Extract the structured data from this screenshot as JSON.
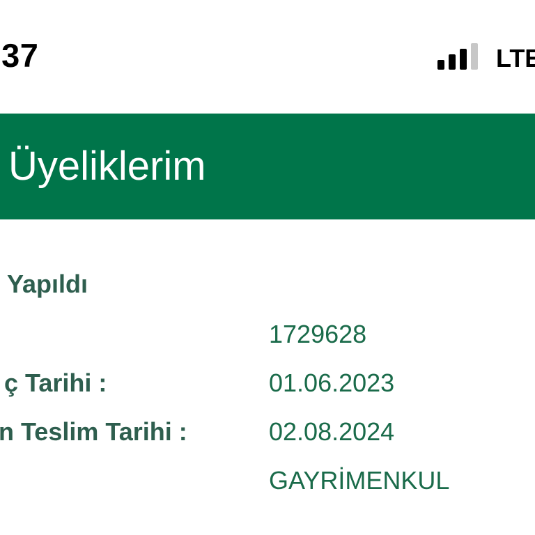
{
  "status_bar": {
    "time": ":37",
    "network": "LTE",
    "signal_bars_active": 3,
    "signal_bars_total": 4
  },
  "header": {
    "title": "Üyeliklerim"
  },
  "membership": {
    "status": "Yapıldı",
    "fields": [
      {
        "label": "",
        "value": "1729628"
      },
      {
        "label": "ç Tarihi :",
        "value": "01.06.2023"
      },
      {
        "label": "n Teslim Tarihi :",
        "value": "02.08.2024"
      },
      {
        "label": "",
        "value": "GAYRİMENKUL"
      }
    ]
  },
  "colors": {
    "header_bg": "#00754a",
    "header_text": "#ffffff",
    "label_text": "#2e5e4e",
    "value_text": "#1a6b4a",
    "signal_active": "#000000",
    "signal_inactive": "#c7c7c7"
  }
}
